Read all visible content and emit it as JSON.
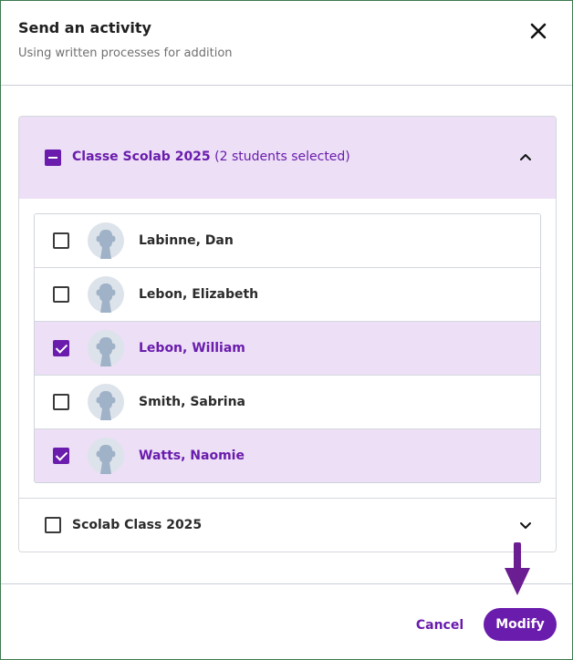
{
  "dialog": {
    "title": "Send an activity",
    "subtitle": "Using written processes for addition",
    "close_icon": "close-icon"
  },
  "groups": [
    {
      "name": "Classe Scolab 2025",
      "summary": "(2 students selected)",
      "state": "partial",
      "expanded": true,
      "students": [
        {
          "name": "Labinne, Dan",
          "selected": false
        },
        {
          "name": "Lebon, Elizabeth",
          "selected": false
        },
        {
          "name": "Lebon, William",
          "selected": true
        },
        {
          "name": "Smith, Sabrina",
          "selected": false
        },
        {
          "name": "Watts, Naomie",
          "selected": true
        }
      ]
    },
    {
      "name": "Scolab Class 2025",
      "state": "unchecked",
      "expanded": false
    }
  ],
  "footer": {
    "cancel_label": "Cancel",
    "modify_label": "Modify"
  },
  "colors": {
    "accent": "#6a1cac",
    "selected_bg": "#ecdff6",
    "annotation_arrow": "#6a1e91"
  }
}
